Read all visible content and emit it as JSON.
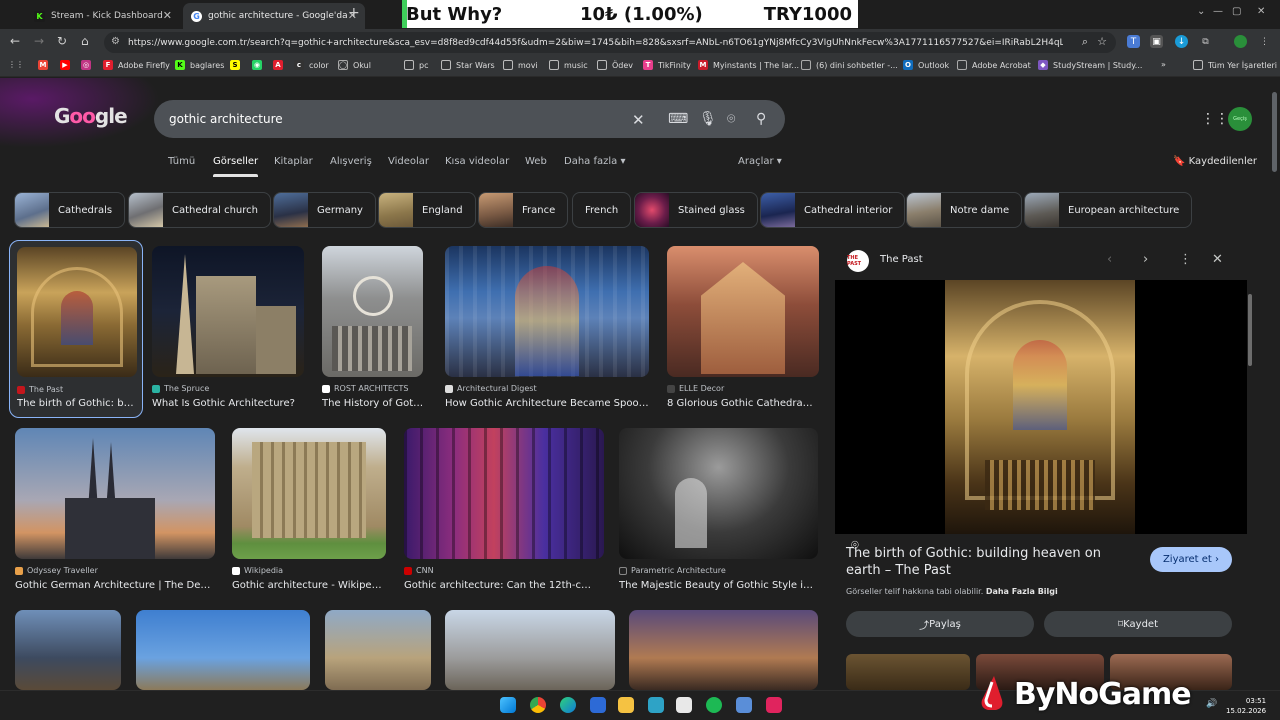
{
  "browser": {
    "tabs": [
      {
        "title": "Stream - Kick Dashboard",
        "favicon": "kick-icon",
        "active": false
      },
      {
        "title": "gothic architecture - Google'da",
        "favicon": "google-icon",
        "active": true
      }
    ],
    "url": "https://www.google.com.tr/search?q=gothic+architecture&sca_esv=d8f8ed9cdf44d55f&udm=2&biw=1745&bih=828&sxsrf=ANbL-n6TO61gYNj8MfcCy3VIgUhNnkFecw%3A1771116577527&ei=IRiRabL2H4qLxc8PqOPFiAw&o...",
    "bookmarks": [
      {
        "label": "Adobe Firefly",
        "color": "#e01e2e"
      },
      {
        "label": "baglares",
        "color": "#53fc18"
      },
      {
        "label": "color",
        "color": "#333333"
      },
      {
        "label": "Okul",
        "color": "#8a8a8a"
      },
      {
        "label": "pc",
        "color": "#8a8a8a"
      },
      {
        "label": "Star Wars",
        "color": "#8a8a8a"
      },
      {
        "label": "movi",
        "color": "#8a8a8a"
      },
      {
        "label": "music",
        "color": "#8a8a8a"
      },
      {
        "label": "Ödev",
        "color": "#8a8a8a"
      },
      {
        "label": "TikFinity",
        "color": "#e83e8c"
      },
      {
        "label": "Myinstants | The lar...",
        "color": "#c91b2a"
      },
      {
        "label": "(6) dini sohbetler -...",
        "color": "#8a8a8a"
      },
      {
        "label": "Outlook",
        "color": "#0f6cbd"
      },
      {
        "label": "Adobe Acrobat",
        "color": "#8a8a8a"
      },
      {
        "label": "StudyStream | Study...",
        "color": "#7e57c2"
      }
    ],
    "other_bookmarks": "Tüm Yer İşaretleri"
  },
  "overlay": {
    "title": "But Why?",
    "goal": "10₺ (1.00%)",
    "target": "TRY1000",
    "progress": 0.01
  },
  "search": {
    "query": "gothic architecture",
    "logo": "Google",
    "avatar_label": "Geçiş"
  },
  "nav": {
    "tabs": [
      "Tümü",
      "Görseller",
      "Kitaplar",
      "Alışveriş",
      "Videolar",
      "Kısa videolar",
      "Web",
      "Daha fazla ▾"
    ],
    "selected": "Görseller",
    "tools": "Araçlar ▾",
    "saved": "Kaydedilenler"
  },
  "chips": [
    "Cathedrals",
    "Cathedral church",
    "Germany",
    "England",
    "France",
    "French",
    "Stained glass",
    "Cathedral interior",
    "Notre dame",
    "European architecture"
  ],
  "results": [
    {
      "source": "The Past",
      "title": "The birth of Gothic: bu...",
      "src_color": "#c4161c"
    },
    {
      "source": "The Spruce",
      "title": "What Is Gothic Architecture?",
      "src_color": "#2bb3a3"
    },
    {
      "source": "ROST ARCHITECTS",
      "title": "The History of Goth...",
      "src_color": "#ffffff"
    },
    {
      "source": "Architectural Digest",
      "title": "How Gothic Architecture Became Spooky...",
      "src_color": "#dddddd"
    },
    {
      "source": "ELLE Decor",
      "title": "8 Glorious Gothic Cathedral...",
      "src_color": "#444444"
    },
    {
      "source": "Odyssey Traveller",
      "title": "Gothic German Architecture | The Defi...",
      "src_color": "#e8a04a"
    },
    {
      "source": "Wikipedia",
      "title": "Gothic architecture - Wikipedia",
      "src_color": "#ffffff"
    },
    {
      "source": "CNN",
      "title": "Gothic architecture: Can the 12th-cent...",
      "src_color": "#cc0000"
    },
    {
      "source": "Parametric Architecture",
      "title": "The Majestic Beauty of Gothic Style in ...",
      "src_color": "#222222"
    }
  ],
  "preview": {
    "source": "The Past",
    "source_badge": "THE PAST",
    "title": "The birth of Gothic: building heaven on earth – The Past",
    "visit": "Ziyaret et ›",
    "copyright": "Görseller telif hakkına tabi olabilir.",
    "more_info": "Daha Fazla Bilgi",
    "share": "Paylaş",
    "save": "Kaydet"
  },
  "taskbar": {
    "time": "03:51",
    "date": "15.02.2026"
  },
  "watermark": "ByNoGame"
}
